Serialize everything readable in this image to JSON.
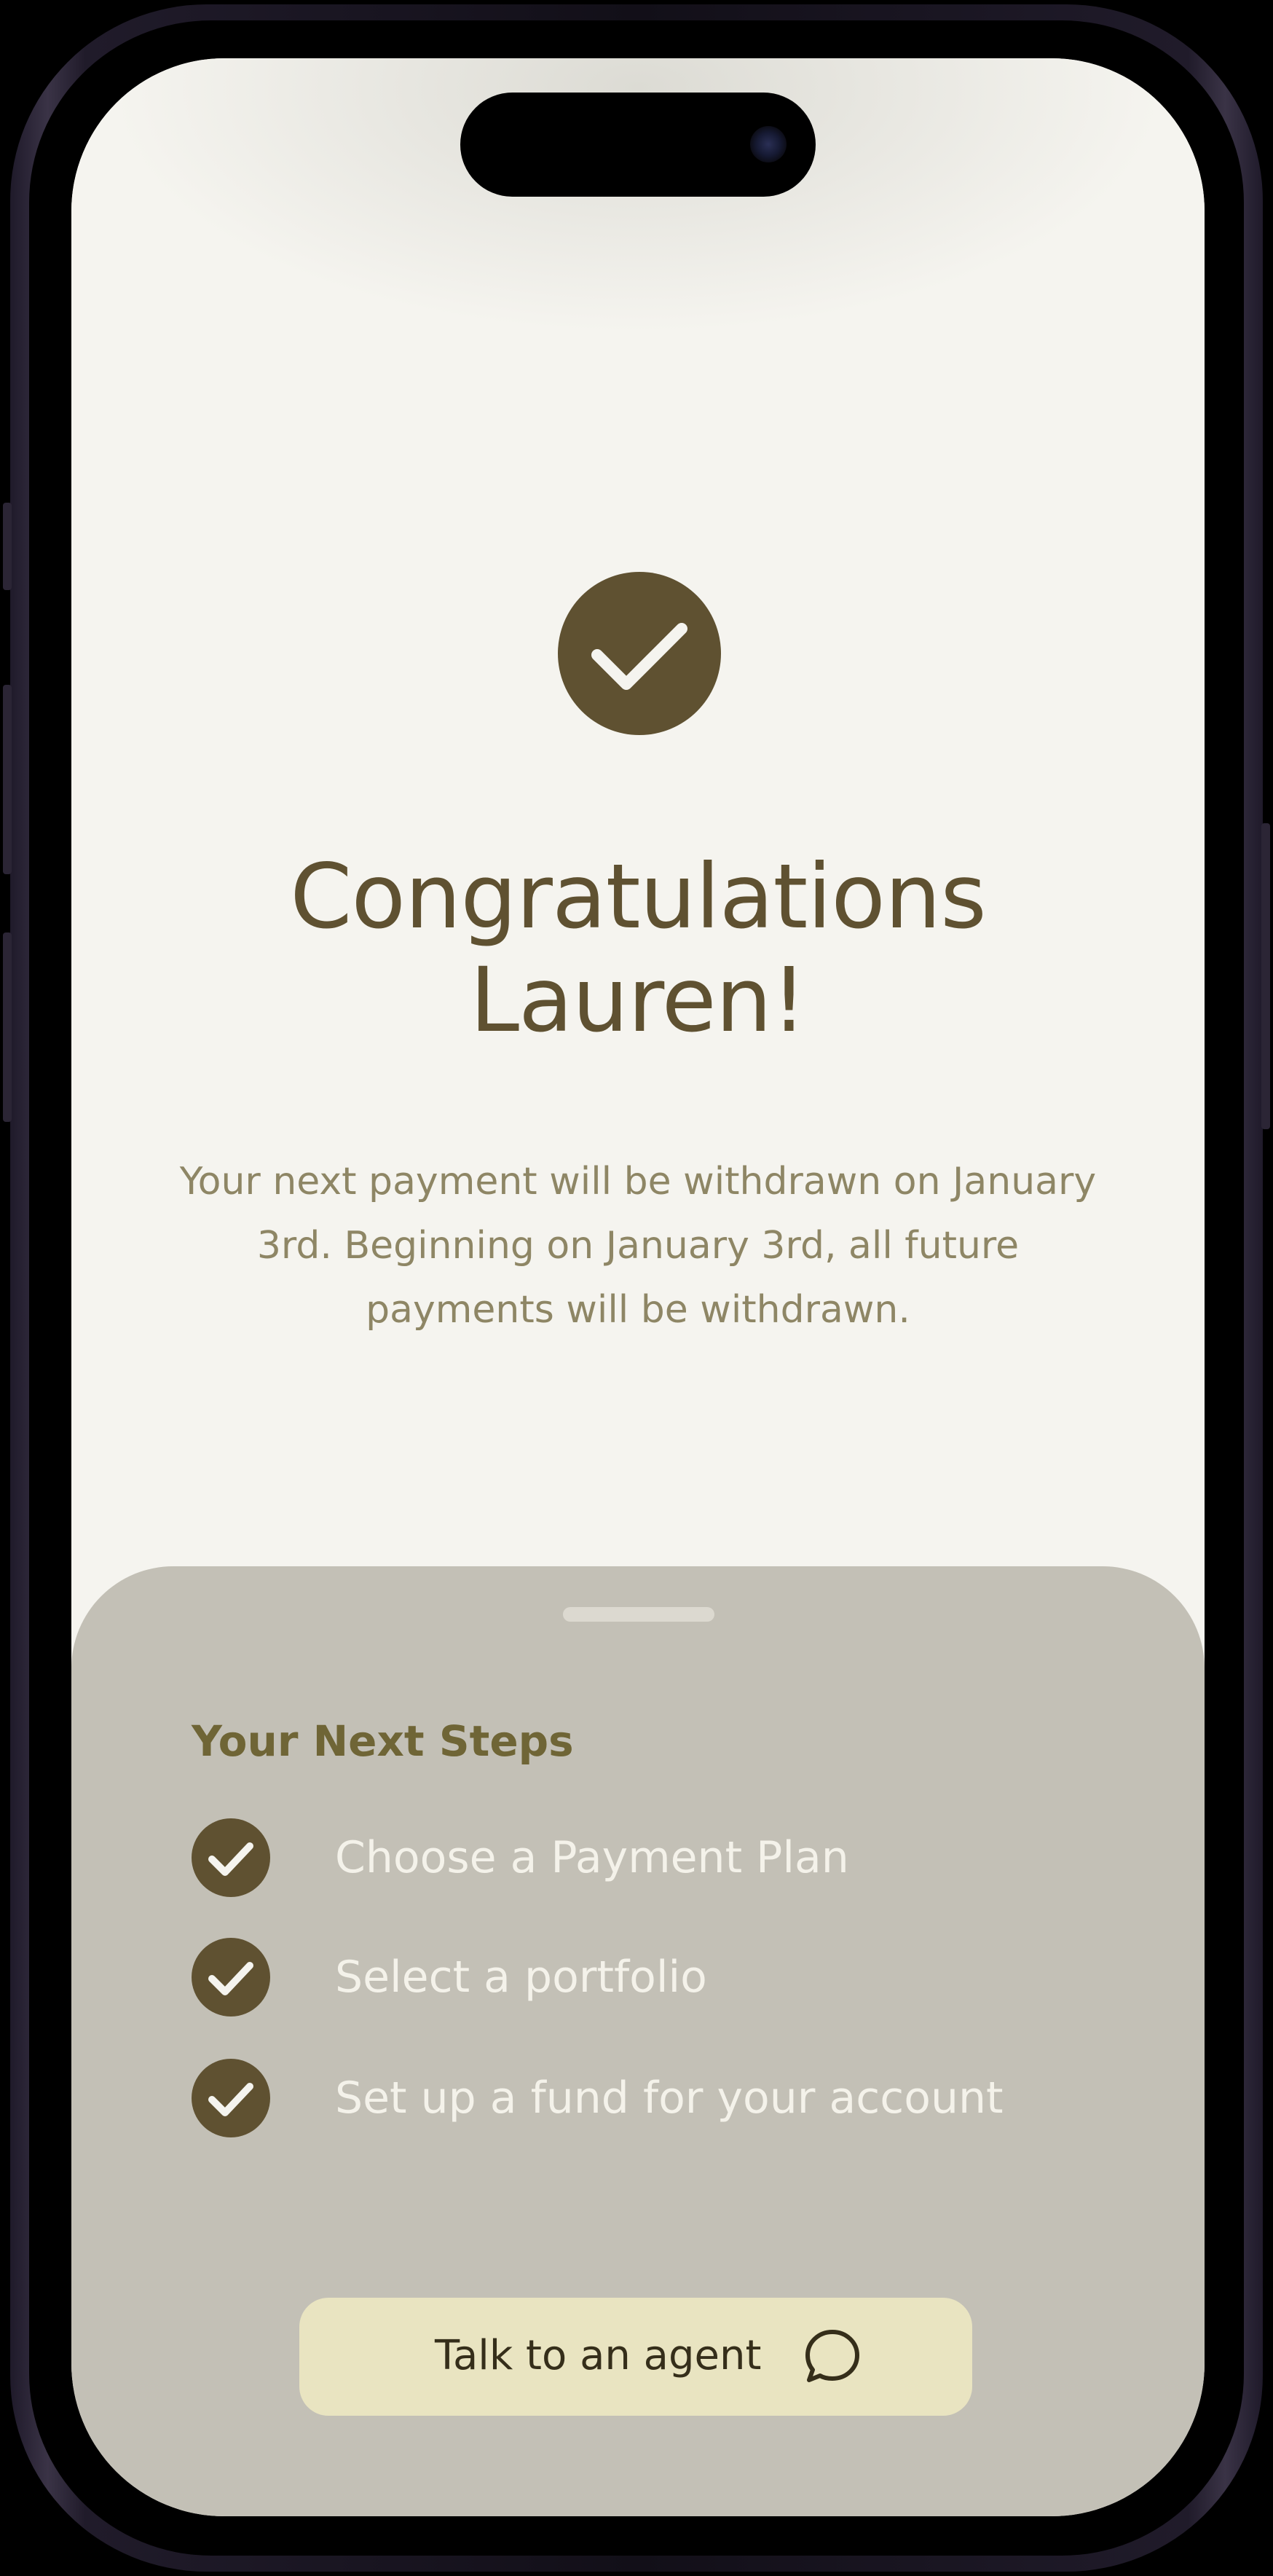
{
  "success": {
    "title_line1": "Congratulations",
    "title_line2": "Lauren!",
    "message_line1": "Your next payment will be withdrawn on January",
    "message_line2": "3rd. Beginning on January 3rd, all future",
    "message_line3": "payments will be withdrawn.",
    "icon": "checkmark-icon"
  },
  "next_steps": {
    "heading": "Your Next Steps",
    "items": [
      {
        "label": "Choose a Payment Plan",
        "completed": true,
        "icon": "checkmark-icon"
      },
      {
        "label": "Select a portfolio",
        "completed": true,
        "icon": "checkmark-icon"
      },
      {
        "label": "Set up a fund for your account",
        "completed": true,
        "icon": "checkmark-icon"
      }
    ]
  },
  "agent_button": {
    "label": "Talk to an agent",
    "icon": "chat-bubble-icon"
  },
  "colors": {
    "accent": "#5f5131",
    "heading_text": "#6f6536",
    "body_text": "#8e8665",
    "sheet_background": "#c3c0b6",
    "screen_background": "#f5f4ef",
    "button_background": "#e9e4c1"
  }
}
